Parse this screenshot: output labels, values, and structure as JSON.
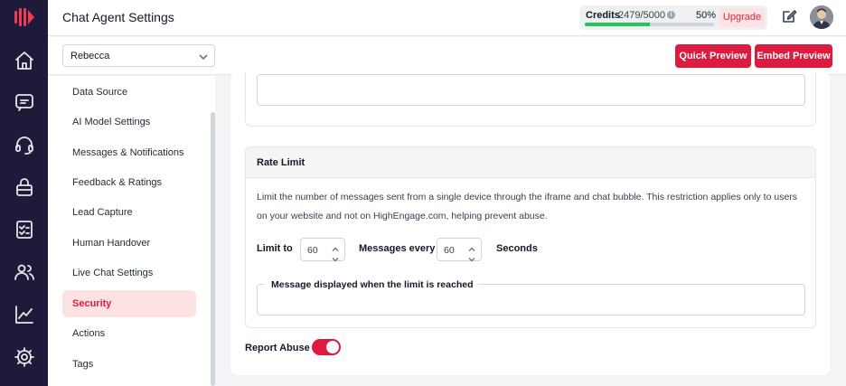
{
  "header": {
    "title": "Chat Agent Settings",
    "credits_label": "Credits",
    "credits_count": "2479/5000",
    "credits_percent_text": "50%",
    "credits_fraction": 0.5,
    "upgrade_label": "Upgrade"
  },
  "toolbar": {
    "agent_value": "Rebecca",
    "quick_preview_label": "Quick Preview",
    "embed_preview_label": "Embed Preview"
  },
  "rail": {
    "icons": [
      "home-icon",
      "chat-icon",
      "headset-icon",
      "bag-icon",
      "checklist-icon",
      "users-icon",
      "chart-icon",
      "gear-icon"
    ]
  },
  "settings_nav": {
    "items": [
      {
        "label": "Data Source"
      },
      {
        "label": "AI Model Settings"
      },
      {
        "label": "Messages & Notifications"
      },
      {
        "label": "Feedback & Ratings"
      },
      {
        "label": "Lead Capture"
      },
      {
        "label": "Human Handover"
      },
      {
        "label": "Live Chat Settings"
      },
      {
        "label": "Security",
        "active": true
      },
      {
        "label": "Actions"
      },
      {
        "label": "Tags"
      }
    ]
  },
  "rate_limit": {
    "title": "Rate Limit",
    "description": "Limit the number of messages sent from a single device through the iframe and chat bubble. This restriction applies only to users on your website and not on HighEngage.com, helping prevent abuse.",
    "limit_to_label": "Limit to",
    "limit_value": "60",
    "messages_every_label": "Messages every",
    "interval_value": "60",
    "seconds_label": "Seconds",
    "message_field_label": "Message displayed when the limit is reached",
    "message_field_value": ""
  },
  "report_abuse": {
    "label": "Report Abuse",
    "enabled": true
  },
  "colors": {
    "accent": "#dc1b3f",
    "rail_bg": "#1e1b3a",
    "progress": "#22c55e"
  }
}
